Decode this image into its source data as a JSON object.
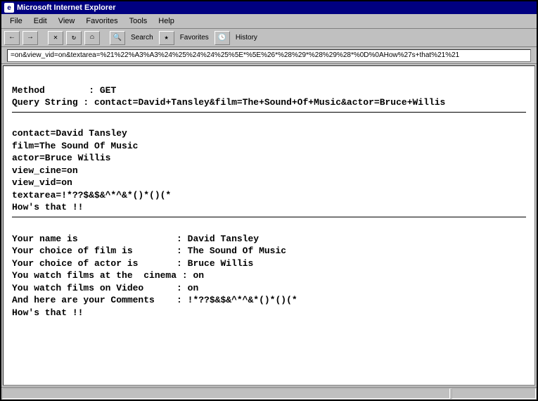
{
  "window": {
    "title": "Microsoft Internet Explorer",
    "icon_glyph": "e"
  },
  "menu": {
    "file": "File",
    "edit": "Edit",
    "view": "View",
    "favorites": "Favorites",
    "tools": "Tools",
    "help": "Help"
  },
  "toolbar": {
    "back": "←",
    "forward": "→",
    "stop": "✕",
    "refresh": "↻",
    "home": "⌂",
    "search_label": "Search",
    "favorites_label": "Favorites",
    "history_label": "History"
  },
  "address": {
    "url": "=on&view_vid=on&textarea=%21%22%A3%A3%24%25%24%24%25%5E*%5E%26*%28%29*%28%29%28*%0D%0AHow%27s+that%21%21"
  },
  "page": {
    "method_label": "Method        :",
    "method_value": "GET",
    "query_label": "Query String :",
    "query_value": "contact=David+Tansley&film=The+Sound+Of+Music&actor=Bruce+Willis",
    "raw": {
      "l1": "contact=David Tansley",
      "l2": "film=The Sound Of Music",
      "l3": "actor=Bruce Willis",
      "l4": "view_cine=on",
      "l5": "view_vid=on",
      "l6": "textarea=!*??$&$&^*^&*()*()(*",
      "l7": "How's that !!"
    },
    "parsed": {
      "name_label": "Your name is                  :",
      "name_value": "David Tansley",
      "film_label": "Your choice of film is        :",
      "film_value": "The Sound Of Music",
      "actor_label": "Your choice of actor is       :",
      "actor_value": "Bruce Willis",
      "cine_label": "You watch films at the  cinema :",
      "cine_value": "on",
      "vid_label": "You watch films on Video      :",
      "vid_value": "on",
      "comments_label": "And here are your Comments    :",
      "comments_value": "!*??$&$&^*^&*()*()(*",
      "closing": "How's that !!"
    }
  },
  "status": {
    "text": ""
  }
}
